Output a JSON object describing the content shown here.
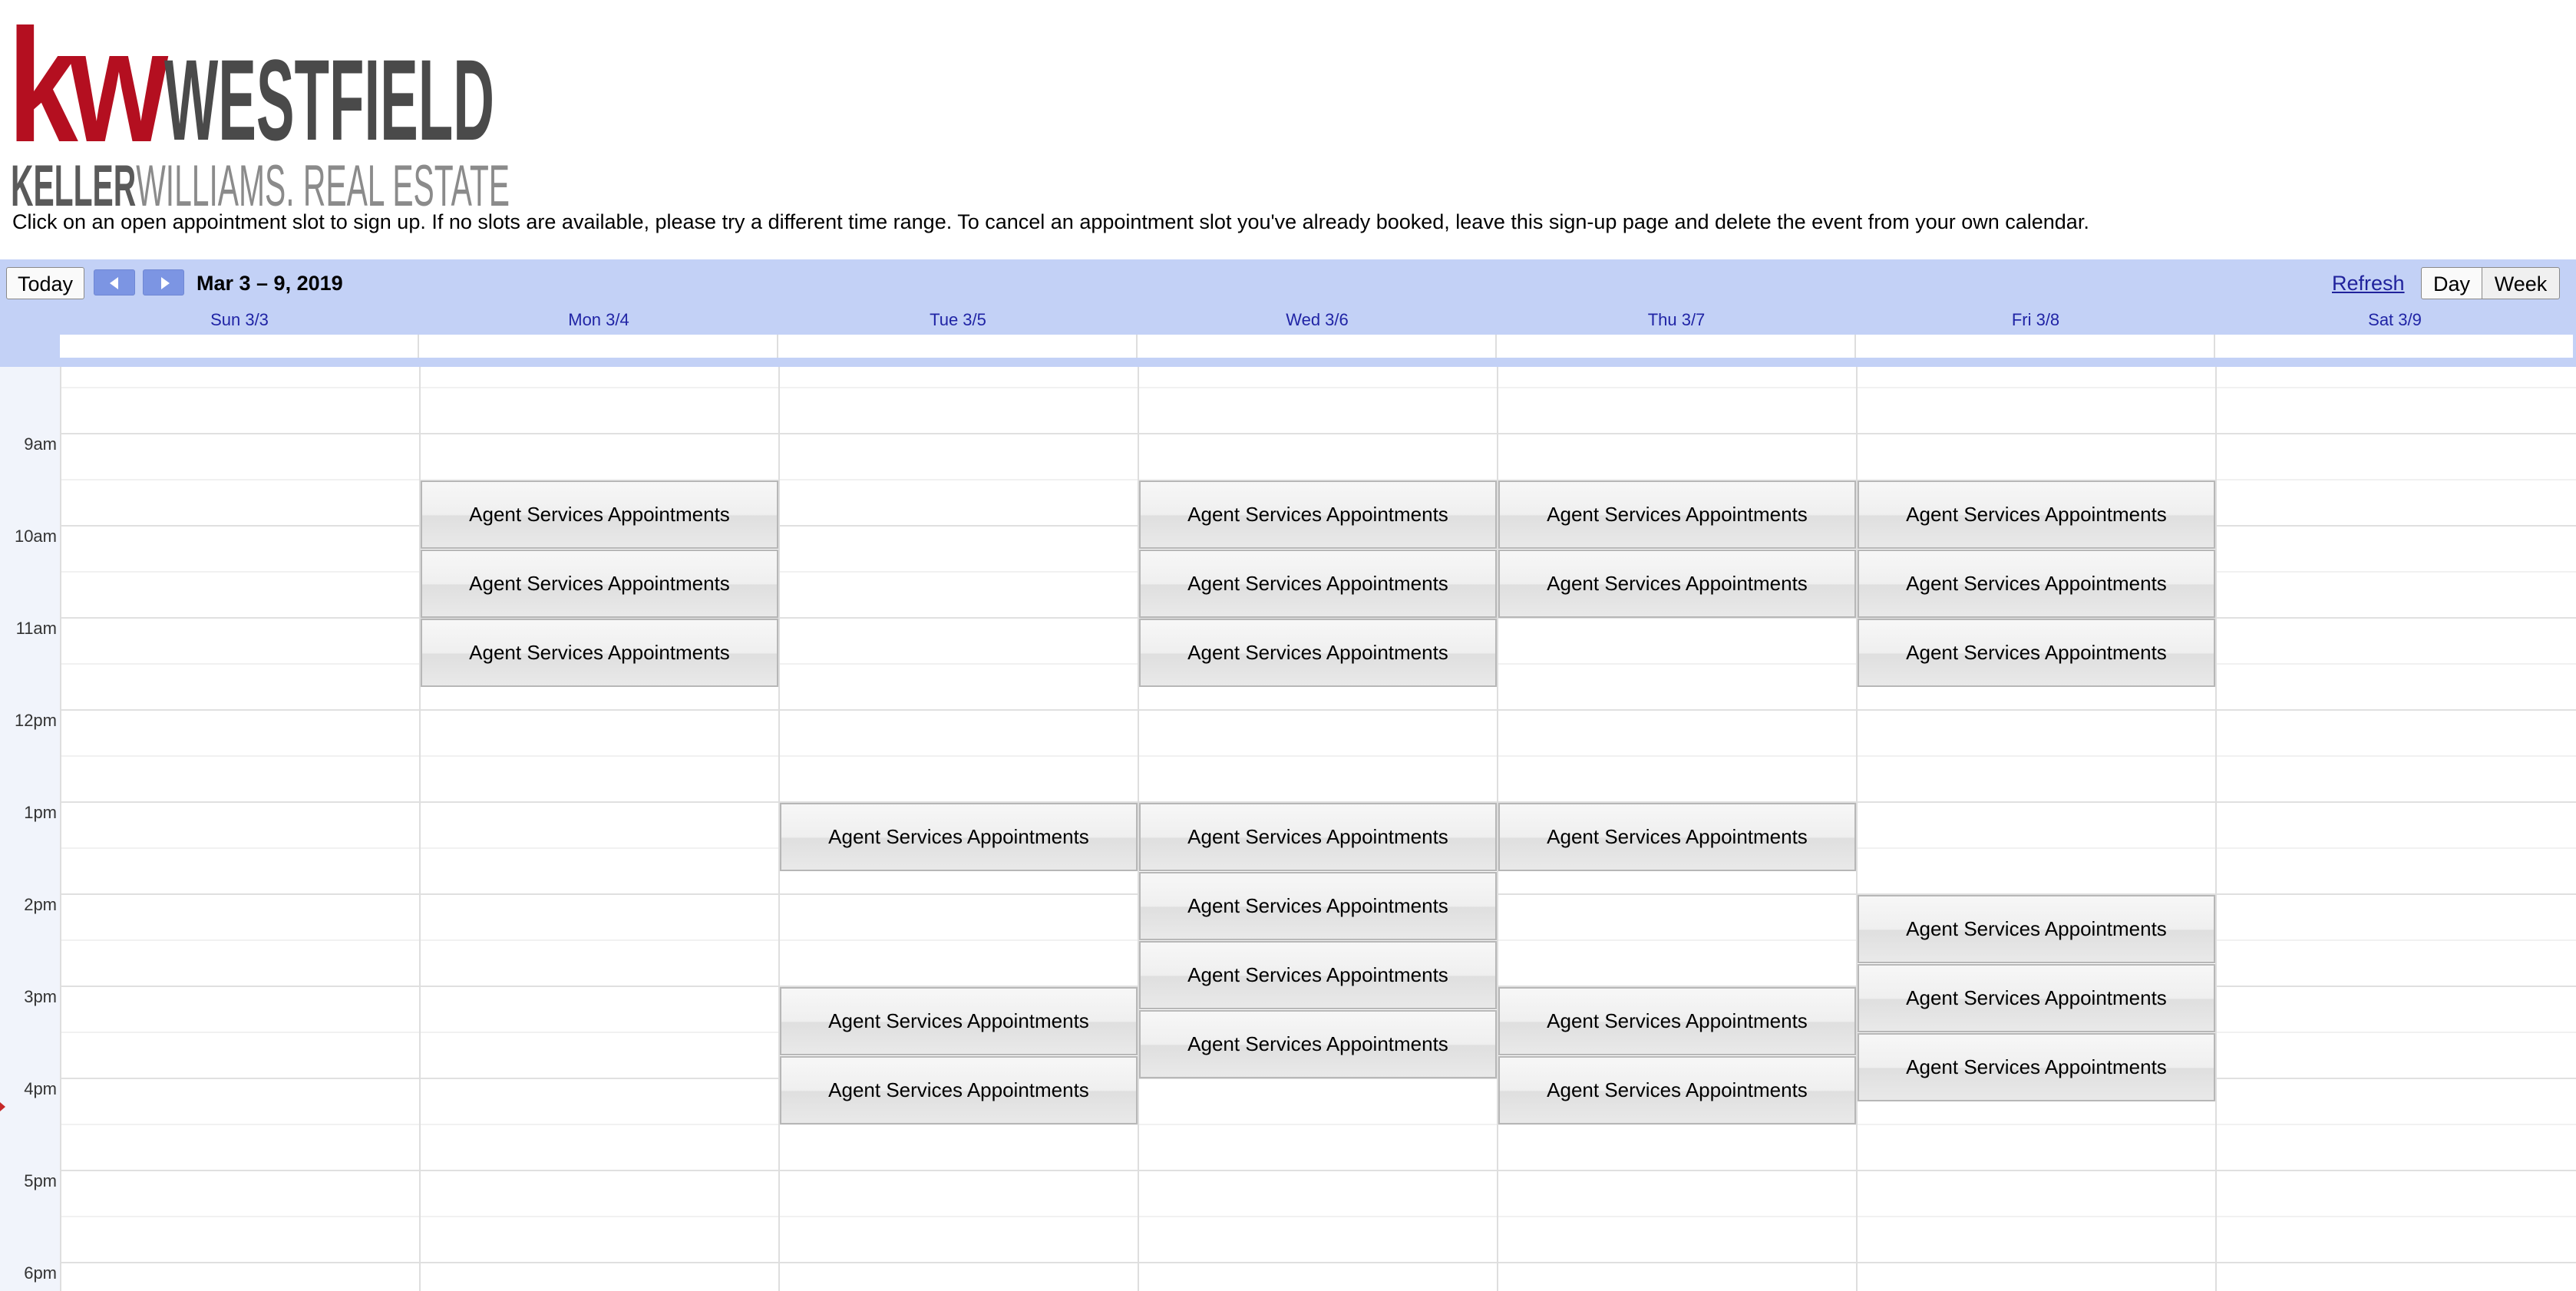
{
  "logo": {
    "kw": "kw",
    "name": "WESTFIELD",
    "tagline_part1": "KELLER",
    "tagline_part2": "WILLIAMS",
    "tagline_part3": "REAL ESTATE",
    "colors": {
      "red": "#b40f20",
      "gray": "#4a4a4a",
      "light_gray": "#8b8b8b"
    }
  },
  "instructions": "Click on an open appointment slot to sign up. If no slots are available, please try a different time range. To cancel an appointment slot you've already booked, leave this sign-up page and delete the event from your own calendar.",
  "toolbar": {
    "today_label": "Today",
    "prev_icon": "chevron-left-icon",
    "next_icon": "chevron-right-icon",
    "date_range": "Mar 3 – 9, 2019",
    "refresh_label": "Refresh",
    "day_label": "Day",
    "week_label": "Week"
  },
  "days": [
    "Sun 3/3",
    "Mon 3/4",
    "Tue 3/5",
    "Wed 3/6",
    "Thu 3/7",
    "Fri 3/8",
    "Sat 3/9"
  ],
  "time_labels": [
    "9am",
    "10am",
    "11am",
    "12pm",
    "1pm",
    "2pm",
    "3pm",
    "4pm",
    "5pm",
    "6pm"
  ],
  "event_title": "Agent Services Appointments",
  "colors": {
    "toolbar_bg": "#c3d1f6",
    "day_header_text": "#2024a5",
    "nav_button": "#7c95e3",
    "event_border": "#b7b7b7"
  }
}
